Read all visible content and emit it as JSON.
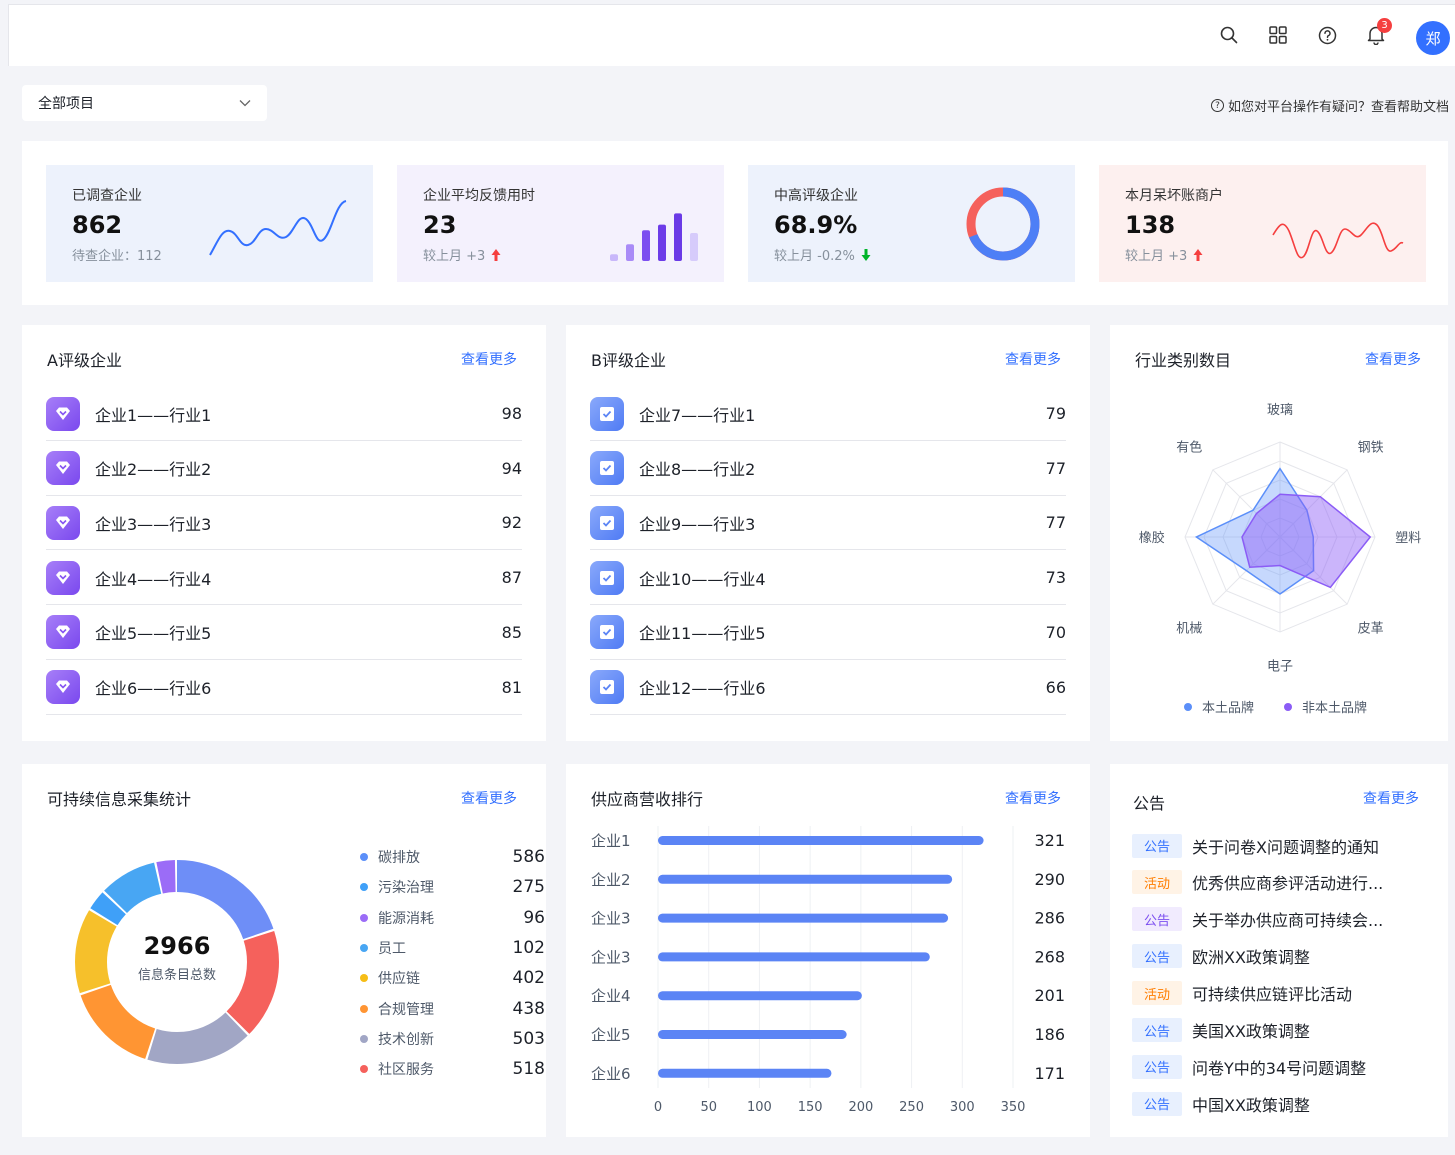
{
  "header": {
    "avatar_text": "郑",
    "notification_count": "3",
    "icons": [
      "search-icon",
      "apps-grid-icon",
      "help-circle-icon",
      "bell-icon"
    ]
  },
  "filter": {
    "project_label": "全部项目"
  },
  "help": {
    "text": "如您对平台操作有疑问？查看帮助文档"
  },
  "stats": [
    {
      "label": "已调查企业",
      "value": "862",
      "sub": "待查企业：112",
      "bg": "#edf2fc",
      "trend": "none"
    },
    {
      "label": "企业平均反馈用时",
      "value": "23",
      "sub": "较上月 +3",
      "bg": "#f4f1fd",
      "trend": "up"
    },
    {
      "label": "中高评级企业",
      "value": "68.9%",
      "sub": "较上月 -0.2%",
      "bg": "#edf2fc",
      "trend": "down"
    },
    {
      "label": "本月呆坏账商户",
      "value": "138",
      "sub": "较上月 +3",
      "bg": "#fdf0ef",
      "trend": "up"
    }
  ],
  "stat_mini": {
    "bars": [
      0.12,
      0.3,
      0.55,
      0.65,
      0.85,
      0.5
    ],
    "donut_percent": 68.9
  },
  "view_more": "查看更多",
  "a_rank": {
    "title": "A评级企业",
    "items": [
      {
        "name": "企业1——行业1",
        "score": "98"
      },
      {
        "name": "企业2——行业2",
        "score": "94"
      },
      {
        "name": "企业3——行业3",
        "score": "92"
      },
      {
        "name": "企业4——行业4",
        "score": "87"
      },
      {
        "name": "企业5——行业5",
        "score": "85"
      },
      {
        "name": "企业6——行业6",
        "score": "81"
      }
    ]
  },
  "b_rank": {
    "title": "B评级企业",
    "items": [
      {
        "name": "企业7——行业1",
        "score": "79"
      },
      {
        "name": "企业8——行业2",
        "score": "77"
      },
      {
        "name": "企业9——行业3",
        "score": "77"
      },
      {
        "name": "企业10——行业4",
        "score": "73"
      },
      {
        "name": "企业11——行业5",
        "score": "70"
      },
      {
        "name": "企业12——行业6",
        "score": "66"
      }
    ]
  },
  "radar": {
    "title": "行业类别数目",
    "legend": [
      "本土品牌",
      "非本土品牌"
    ]
  },
  "sustain": {
    "title": "可持续信息采集统计",
    "total": "2966",
    "total_label": "信息条目总数"
  },
  "supplier": {
    "title": "供应商营收排行"
  },
  "notices": {
    "title": "公告",
    "items": [
      {
        "tag": "公告",
        "type": "notice",
        "text": "关于问卷X问题调整的通知"
      },
      {
        "tag": "活动",
        "type": "activity",
        "text": "优秀供应商参评活动进行..."
      },
      {
        "tag": "公告",
        "type": "purple",
        "text": "关于举办供应商可持续会..."
      },
      {
        "tag": "公告",
        "type": "notice",
        "text": "欧洲XX政策调整"
      },
      {
        "tag": "活动",
        "type": "activity",
        "text": "可持续供应链评比活动"
      },
      {
        "tag": "公告",
        "type": "notice",
        "text": "美国XX政策调整"
      },
      {
        "tag": "公告",
        "type": "notice",
        "text": "问卷Y中的34号问题调整"
      },
      {
        "tag": "公告",
        "type": "notice",
        "text": "中国XX政策调整"
      }
    ]
  },
  "chart_data": [
    {
      "type": "radar",
      "axes": [
        "玻璃",
        "钢铁",
        "塑料",
        "皮革",
        "电子",
        "机械",
        "橡胶",
        "有色"
      ],
      "series": [
        {
          "name": "本土品牌",
          "values": [
            72,
            40,
            35,
            50,
            60,
            50,
            88,
            40
          ],
          "color": "#5b8ff9"
        },
        {
          "name": "非本土品牌",
          "values": [
            45,
            60,
            95,
            75,
            30,
            45,
            40,
            35
          ],
          "color": "#8b5cf6"
        }
      ],
      "max": 100
    },
    {
      "type": "pie",
      "categories": [
        "碳排放",
        "污染治理",
        "能源消耗",
        "员工",
        "供应链",
        "合规管理",
        "技术创新",
        "社区服务"
      ],
      "values": [
        586,
        275,
        96,
        102,
        402,
        438,
        503,
        518
      ],
      "legend_colors": [
        "#5b8ff9",
        "#3fa0f8",
        "#9b6cf7",
        "#48a6f3",
        "#f6bd16",
        "#ff9533",
        "#a1a6c5",
        "#f5615c"
      ],
      "ring_order": [
        "碳排放",
        "社区服务",
        "技术创新",
        "合规管理",
        "供应链",
        "员工",
        "污染治理",
        "能源消耗"
      ],
      "ring_colors": [
        "#6e8ef7",
        "#f5615c",
        "#a1a6c5",
        "#ff9533",
        "#f6c02b",
        "#3fa0f8",
        "#48a6f3",
        "#9b6cf7"
      ]
    },
    {
      "type": "bar",
      "orientation": "horizontal",
      "categories": [
        "企业1",
        "企业2",
        "企业3",
        "企业3",
        "企业4",
        "企业5",
        "企业6"
      ],
      "values": [
        321,
        290,
        286,
        268,
        201,
        186,
        171
      ],
      "xlim": [
        0,
        350
      ],
      "xticks": [
        0,
        50,
        100,
        150,
        200,
        250,
        300,
        350
      ]
    }
  ]
}
